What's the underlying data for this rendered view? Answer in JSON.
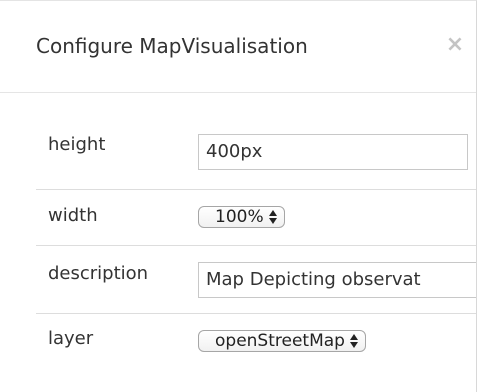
{
  "dialog": {
    "title": "Configure MapVisualisation",
    "close_glyph": "×"
  },
  "fields": [
    {
      "label": "height",
      "type": "text",
      "value": "400px"
    },
    {
      "label": "width",
      "type": "select",
      "value": "100%"
    },
    {
      "label": "description",
      "type": "text",
      "value": "Map Depicting observat"
    },
    {
      "label": "layer",
      "type": "select",
      "value": "openStreetMap"
    }
  ],
  "icons": {
    "close": "close-icon",
    "select_arrows": "updown-arrows-icon"
  },
  "colors": {
    "border": "#dddddd",
    "close": "#c4c4c4",
    "text": "#333333"
  }
}
